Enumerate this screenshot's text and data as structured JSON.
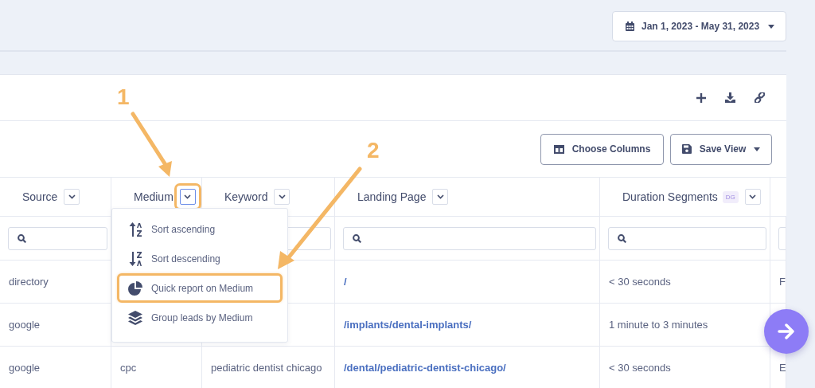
{
  "date_range": {
    "label": "Jan 1, 2023 - May 31, 2023"
  },
  "card_actions": [
    {
      "kind": "add"
    },
    {
      "kind": "download"
    },
    {
      "kind": "link"
    }
  ],
  "toolbar": {
    "buttons": [
      {
        "label": "Choose Columns",
        "kind": "columns"
      },
      {
        "label": "Save View",
        "kind": "save"
      }
    ]
  },
  "table": {
    "columns": [
      {
        "label": "Source",
        "active": false,
        "highlighted": false
      },
      {
        "label": "Medium",
        "active": true,
        "highlighted": true
      },
      {
        "label": "Keyword",
        "active": false,
        "highlighted": false
      },
      {
        "label": "Landing Page",
        "active": false,
        "highlighted": false
      },
      {
        "label": "Duration Segments",
        "badge": "DG",
        "active": false,
        "highlighted": false
      },
      {
        "kind": "cut_off"
      }
    ],
    "rows": [
      {
        "source": "directory",
        "landing_page": "/",
        "duration": "< 30 seconds",
        "column_6": "F"
      },
      {
        "source": "google",
        "landing_page": "/implants/dental-implants/",
        "duration": "1 minute to 3 minutes"
      },
      {
        "source": "google",
        "medium": "cpc",
        "keyword": "pediatric dentist chicago",
        "landing_page": "/dental/pediatric-dentist-chicago/",
        "duration": "< 30 seconds",
        "column_6": "E"
      }
    ],
    "column_menu": {
      "items": [
        {
          "label": "Sort ascending",
          "kind": "sort_asc",
          "highlighted": false
        },
        {
          "label": "Sort descending",
          "kind": "sort_desc",
          "highlighted": false
        },
        {
          "label": "Quick report on Medium",
          "kind": "report",
          "highlighted": true
        },
        {
          "label": "Group leads by Medium",
          "kind": "group",
          "highlighted": false
        }
      ]
    }
  },
  "annotations": [
    {
      "label": "1"
    },
    {
      "label": "2"
    }
  ]
}
